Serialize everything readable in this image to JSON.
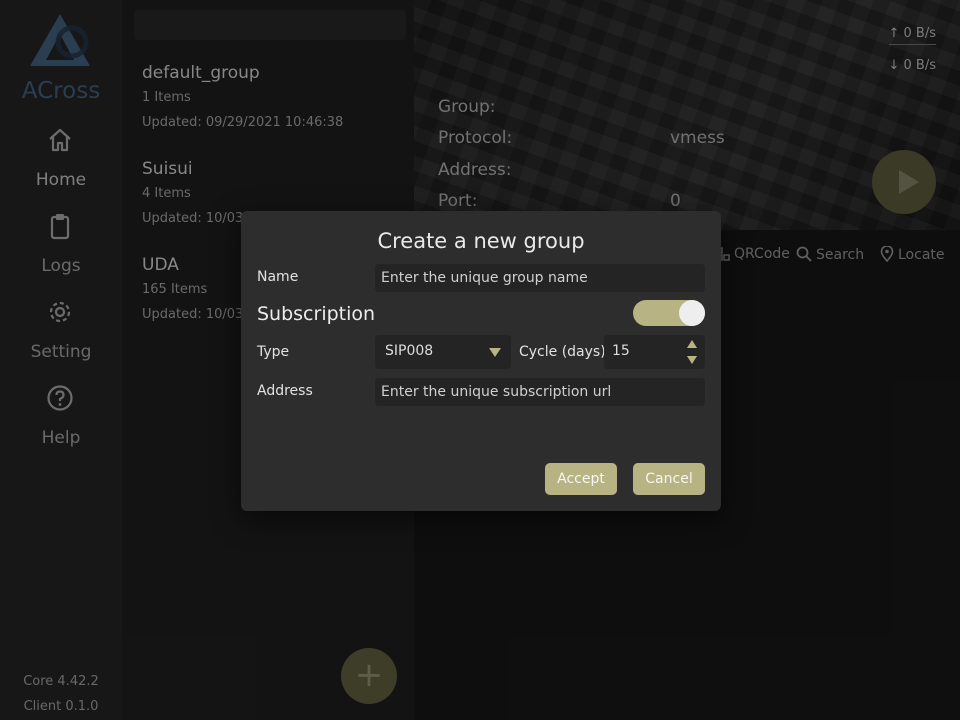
{
  "app": {
    "name": "ACross",
    "core_version": "Core 4.42.2",
    "client_version": "Client 0.1.0"
  },
  "nav": [
    {
      "label": "Home",
      "icon": "home-icon"
    },
    {
      "label": "Logs",
      "icon": "clipboard-icon"
    },
    {
      "label": "Setting",
      "icon": "gear-icon"
    },
    {
      "label": "Help",
      "icon": "help-icon"
    }
  ],
  "groups": [
    {
      "name": "default_group",
      "count": "1 Items",
      "updated": "Updated: 09/29/2021 10:46:38"
    },
    {
      "name": "Suisui",
      "count": "4 Items",
      "updated": "Updated: 10/03"
    },
    {
      "name": "UDA",
      "count": "165 Items",
      "updated": "Updated: 10/03"
    }
  ],
  "fab_label": "+",
  "speed": {
    "upload": "↑ 0 B/s",
    "download": "↓ 0 B/s"
  },
  "details": {
    "group_label": "Group:",
    "protocol_label": "Protocol:",
    "protocol_value": "vmess",
    "address_label": "Address:",
    "port_label": "Port:",
    "port_value": "0"
  },
  "tools": {
    "qrcode": "QRCode",
    "search": "Search",
    "locate": "Locate"
  },
  "dialog": {
    "title": "Create a new group",
    "name_label": "Name",
    "name_placeholder": "Enter the unique group name",
    "subscription_label": "Subscription",
    "subscription_enabled": true,
    "type_label": "Type",
    "type_value": "SIP008",
    "cycle_label": "Cycle (days)",
    "cycle_value": "15",
    "address_label": "Address",
    "address_placeholder": "Enter the unique subscription url",
    "accept_label": "Accept",
    "cancel_label": "Cancel"
  },
  "colors": {
    "accent": "#b8b383",
    "logo": "#3f5c78",
    "background": "#1b1b1b",
    "dialog": "#2d2d2d"
  }
}
